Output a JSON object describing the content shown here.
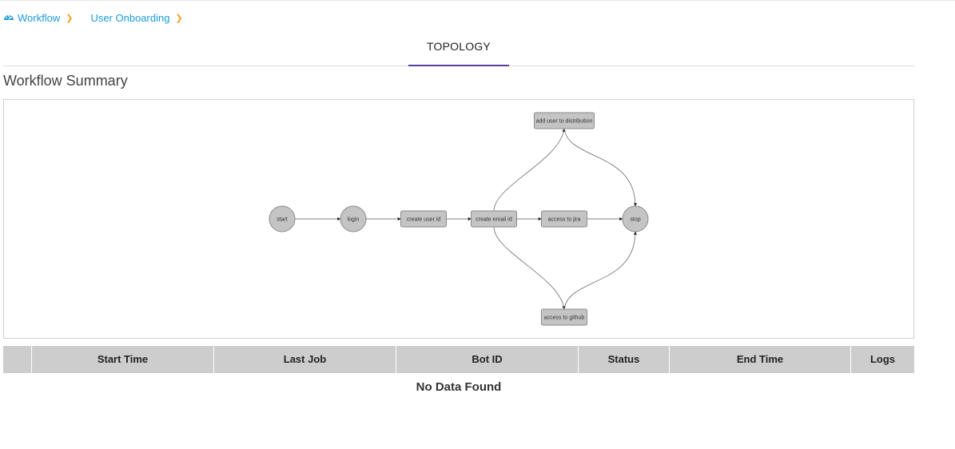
{
  "breadcrumb": {
    "items": [
      {
        "label": "Workflow",
        "icon": "dashboard-icon"
      },
      {
        "label": "User Onboarding"
      }
    ],
    "separator": "❯"
  },
  "tabs": [
    {
      "label": "TOPOLOGY",
      "active": true
    }
  ],
  "section_title": "Workflow Summary",
  "workflow": {
    "nodes": [
      {
        "id": "start",
        "label": "start",
        "shape": "circle"
      },
      {
        "id": "login",
        "label": "login",
        "shape": "circle"
      },
      {
        "id": "create_user_id",
        "label": "create user id",
        "shape": "rect"
      },
      {
        "id": "create_email_id",
        "label": "create email id",
        "shape": "rect"
      },
      {
        "id": "add_user_to_distribution",
        "label": "add user to distribution",
        "shape": "rect"
      },
      {
        "id": "access_to_jira",
        "label": "access to jira",
        "shape": "rect"
      },
      {
        "id": "access_to_github",
        "label": "access to github",
        "shape": "rect"
      },
      {
        "id": "stop",
        "label": "stop",
        "shape": "circle"
      }
    ],
    "edges": [
      [
        "start",
        "login"
      ],
      [
        "login",
        "create_user_id"
      ],
      [
        "create_user_id",
        "create_email_id"
      ],
      [
        "create_email_id",
        "add_user_to_distribution"
      ],
      [
        "create_email_id",
        "access_to_jira"
      ],
      [
        "create_email_id",
        "access_to_github"
      ],
      [
        "add_user_to_distribution",
        "stop"
      ],
      [
        "access_to_jira",
        "stop"
      ],
      [
        "access_to_github",
        "stop"
      ]
    ],
    "colors": {
      "node_fill": "#c4c4c4",
      "node_stroke": "#8a8a8a",
      "edge": "#555555"
    }
  },
  "table": {
    "columns": [
      "",
      "Start Time",
      "Last Job",
      "Bot ID",
      "Status",
      "End Time",
      "Logs"
    ],
    "empty_message": "No Data Found"
  }
}
